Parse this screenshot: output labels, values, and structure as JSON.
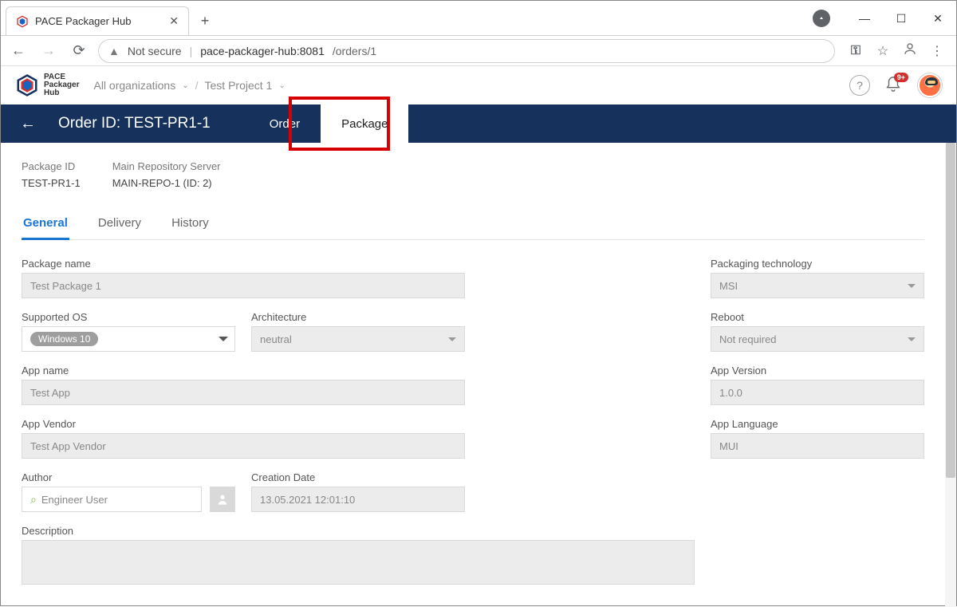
{
  "browser": {
    "tab_title": "PACE Packager Hub",
    "url_host": "pace-packager-hub:8081",
    "url_path": "/orders/1",
    "not_secure": "Not secure"
  },
  "app": {
    "logo_lines": [
      "PACE",
      "Packager",
      "Hub"
    ],
    "breadcrumb": {
      "org": "All organizations",
      "project": "Test Project 1"
    },
    "notification_count": "9+"
  },
  "order": {
    "title": "Order ID: TEST-PR1-1",
    "tabs": {
      "order": "Order",
      "package": "Package"
    },
    "active_tab": "package"
  },
  "package_info": {
    "id_label": "Package ID",
    "id_value": "TEST-PR1-1",
    "repo_label": "Main Repository Server",
    "repo_value": "MAIN-REPO-1 (ID: 2)"
  },
  "subtabs": {
    "general": "General",
    "delivery": "Delivery",
    "history": "History",
    "active": "general"
  },
  "form": {
    "package_name": {
      "label": "Package name",
      "value": "Test Package 1"
    },
    "packaging_tech": {
      "label": "Packaging technology",
      "value": "MSI"
    },
    "supported_os": {
      "label": "Supported OS",
      "chip": "Windows 10"
    },
    "architecture": {
      "label": "Architecture",
      "value": "neutral"
    },
    "reboot": {
      "label": "Reboot",
      "value": "Not required"
    },
    "app_name": {
      "label": "App name",
      "value": "Test App"
    },
    "app_version": {
      "label": "App Version",
      "value": "1.0.0"
    },
    "app_vendor": {
      "label": "App Vendor",
      "value": "Test App Vendor"
    },
    "app_language": {
      "label": "App Language",
      "value": "MUI"
    },
    "author": {
      "label": "Author",
      "value": "Engineer User"
    },
    "creation_date": {
      "label": "Creation Date",
      "value": "13.05.2021 12:01:10"
    },
    "description": {
      "label": "Description",
      "value": ""
    }
  }
}
